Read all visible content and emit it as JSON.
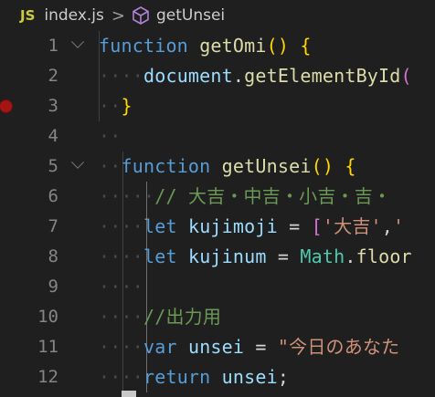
{
  "breadcrumb": {
    "file_icon_label": "JS",
    "file": "index.js",
    "separator": ">",
    "symbol_icon": "cube-icon",
    "symbol": "getUnsei"
  },
  "colors": {
    "keyword": "#569cd6",
    "function": "#dcdcaa",
    "variable": "#9cdcfe",
    "string": "#ce9178",
    "comment": "#6a9955",
    "bracket_level1": "#ffd700",
    "bracket_level2": "#da70d6",
    "breakpoint": "#a31515"
  },
  "editor": {
    "breakpoint_line": 3,
    "lines": [
      {
        "num": "1",
        "dots": "",
        "t": [
          [
            "kw",
            "function"
          ],
          [
            "punc",
            " "
          ],
          [
            "fn",
            "getOmi"
          ],
          [
            "br1",
            "()"
          ],
          [
            "punc",
            " "
          ],
          [
            "br1",
            "{"
          ]
        ]
      },
      {
        "num": "2",
        "dots": "····",
        "t": [
          [
            "var",
            "document"
          ],
          [
            "punc",
            "."
          ],
          [
            "fn",
            "getElementById"
          ],
          [
            "br2",
            "("
          ]
        ]
      },
      {
        "num": "3",
        "dots": "··",
        "t": [
          [
            "br1",
            "}"
          ]
        ]
      },
      {
        "num": "4",
        "dots": "··",
        "t": []
      },
      {
        "num": "5",
        "dots": "··",
        "t": [
          [
            "kw",
            "function"
          ],
          [
            "punc",
            " "
          ],
          [
            "fn",
            "getUnsei"
          ],
          [
            "br1",
            "()"
          ],
          [
            "punc",
            " "
          ],
          [
            "br1",
            "{"
          ]
        ]
      },
      {
        "num": "6",
        "dots": "·····",
        "t": [
          [
            "cmt",
            "// 大吉・中吉・小吉・吉・"
          ]
        ]
      },
      {
        "num": "7",
        "dots": "····",
        "t": [
          [
            "kw",
            "let"
          ],
          [
            "punc",
            " "
          ],
          [
            "var",
            "kujimoji"
          ],
          [
            "punc",
            " = "
          ],
          [
            "br2",
            "["
          ],
          [
            "str",
            "'大吉'"
          ],
          [
            "punc",
            ","
          ],
          [
            "str",
            "'"
          ]
        ]
      },
      {
        "num": "8",
        "dots": "····",
        "t": [
          [
            "kw",
            "let"
          ],
          [
            "punc",
            " "
          ],
          [
            "var",
            "kujinum"
          ],
          [
            "punc",
            " = "
          ],
          [
            "obj",
            "Math"
          ],
          [
            "punc",
            "."
          ],
          [
            "fn",
            "floor"
          ]
        ]
      },
      {
        "num": "9",
        "dots": "····",
        "t": []
      },
      {
        "num": "10",
        "dots": "····",
        "t": [
          [
            "cmt",
            "//出力用"
          ]
        ]
      },
      {
        "num": "11",
        "dots": "····",
        "t": [
          [
            "kw",
            "var"
          ],
          [
            "punc",
            " "
          ],
          [
            "var",
            "unsei"
          ],
          [
            "punc",
            " = "
          ],
          [
            "str",
            "\"今日のあなた"
          ]
        ]
      },
      {
        "num": "12",
        "dots": "····",
        "t": [
          [
            "kw",
            "return"
          ],
          [
            "punc",
            " "
          ],
          [
            "var",
            "unsei"
          ],
          [
            "punc",
            ";"
          ]
        ]
      }
    ]
  }
}
